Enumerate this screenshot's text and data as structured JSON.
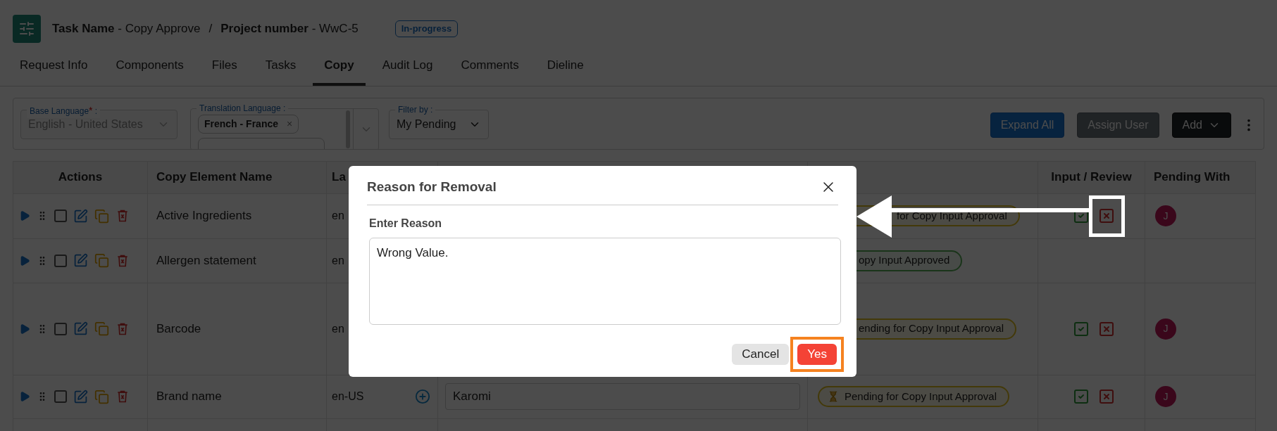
{
  "header": {
    "task_label": "Task Name",
    "dash": "-",
    "task_value": "Copy Approve",
    "separator": "/",
    "project_label": "Project number",
    "project_value": "WwC-5",
    "status_badge": "In-progress"
  },
  "tabs": [
    {
      "label": "Request Info",
      "selected": false
    },
    {
      "label": "Components",
      "selected": false
    },
    {
      "label": "Files",
      "selected": false
    },
    {
      "label": "Tasks",
      "selected": false
    },
    {
      "label": "Copy",
      "selected": true
    },
    {
      "label": "Audit Log",
      "selected": false
    },
    {
      "label": "Comments",
      "selected": false
    },
    {
      "label": "Dieline",
      "selected": false
    }
  ],
  "filters": {
    "base_language": {
      "label": "Base Language",
      "required_mark": "*",
      "label_suffix": " :",
      "value": "English - United States",
      "disabled": true
    },
    "translation_language": {
      "label": "Translation Language :",
      "chips": [
        {
          "text": "French - France",
          "remove": "×"
        }
      ],
      "more_chips_below": true
    },
    "filter_by": {
      "label": "Filter by :",
      "value": "My Pending"
    },
    "buttons": [
      {
        "label": "Expand All",
        "kind": "primary"
      },
      {
        "label": "Assign User",
        "kind": "secondary"
      },
      {
        "label": "Add",
        "kind": "dropdown"
      }
    ]
  },
  "table": {
    "columns": [
      "Actions",
      "Copy Element Name",
      "La",
      "Input / Review",
      "Pending With"
    ],
    "rows": [
      {
        "checked": false,
        "name": "Active Ingredients",
        "language": "en",
        "add_button": false,
        "status": {
          "text": "for Copy Input Approval",
          "kind": "pending",
          "cut": true
        },
        "review_controls": true,
        "reject_highlighted": true,
        "pending_with": "J"
      },
      {
        "checked": false,
        "name": "Allergen statement",
        "language": "en",
        "add_button": false,
        "status": {
          "text": "opy Input Approved",
          "kind": "approved",
          "cut": true
        },
        "review_controls": false,
        "reject_highlighted": false
      },
      {
        "checked": false,
        "name": "Barcode",
        "language": "en",
        "add_button": false,
        "status": {
          "text": "ending for Copy Input Approval",
          "kind": "pending",
          "cut": true
        },
        "review_controls": true,
        "reject_highlighted": false,
        "pending_with": "J"
      },
      {
        "checked": false,
        "name": "Brand name",
        "language": "en-US",
        "add_button": true,
        "value": "Karomi",
        "status": {
          "text": "Pending for Copy Input Approval",
          "kind": "pending",
          "cut": false
        },
        "review_controls": true,
        "reject_highlighted": false,
        "pending_with": "J"
      }
    ]
  },
  "modal": {
    "title": "Reason for Removal",
    "field_label": "Enter Reason",
    "value": "Wrong Value.",
    "buttons": [
      {
        "label": "Cancel",
        "kind": "cancel",
        "highlighted": false
      },
      {
        "label": "Yes",
        "kind": "confirm",
        "highlighted": true
      }
    ]
  }
}
